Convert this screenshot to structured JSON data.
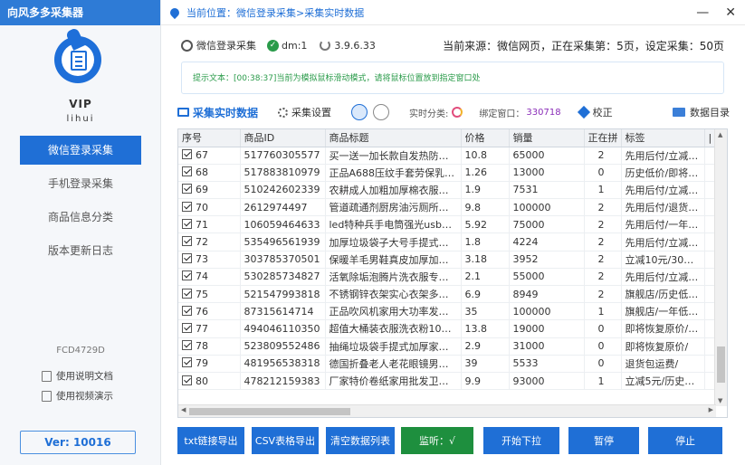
{
  "app": {
    "title": "向风多多采集器"
  },
  "sidebar": {
    "vip_label": "VIP",
    "username": "lihui",
    "nav": [
      {
        "label": "微信登录采集",
        "active": true
      },
      {
        "label": "手机登录采集",
        "active": false
      },
      {
        "label": "商品信息分类",
        "active": false
      },
      {
        "label": "版本更新日志",
        "active": false
      }
    ],
    "device_code": "FCD4729D",
    "links": {
      "doc": "使用说明文档",
      "video": "使用视频演示"
    },
    "version": "Ver: 10016"
  },
  "header": {
    "breadcrumb": "当前位置：微信登录采集>采集实时数据",
    "minimize": "—",
    "close": "✕"
  },
  "status": {
    "mode": "微信登录采集",
    "dm": "dm:1",
    "version": "3.9.6.33",
    "source_info": "当前来源：微信网页，正在采集第：5页，设定采集：50页"
  },
  "tip": "提示文本：[00:38:37]当前为模拟鼠标滑动模式，请将鼠标位置放到指定窗口处",
  "toolbar": {
    "tab_realtime": "采集实时数据",
    "tab_settings": "采集设置",
    "realtime_category": "实时分类:",
    "bind_window_label": "绑定窗口：",
    "bind_window_value": "330718",
    "calibrate": "校正",
    "data_dir": "数据目录"
  },
  "table": {
    "columns": [
      "序号",
      "商品ID",
      "商品标题",
      "价格",
      "销量",
      "正在拼",
      "标签",
      "|"
    ],
    "rows": [
      [
        "67",
        "517760305577",
        "买一送一加长款自发热防…",
        "10.8",
        "65000",
        "2",
        "先用后付/立减…"
      ],
      [
        "68",
        "517883810979",
        "正品A688压纹手套劳保乳…",
        "1.26",
        "13000",
        "0",
        "历史低价/即将…"
      ],
      [
        "69",
        "510242602339",
        "农耕成人加粗加厚棉衣服…",
        "1.9",
        "7531",
        "1",
        "先用后付/立减…"
      ],
      [
        "70",
        "2612974497",
        "管道疏通剂厨房油污厕所…",
        "9.8",
        "100000",
        "2",
        "先用后付/退货…"
      ],
      [
        "71",
        "106059464633",
        "led特种兵手电筒强光usb…",
        "5.92",
        "75000",
        "2",
        "先用后付/一年…"
      ],
      [
        "72",
        "535496561939",
        "加厚垃圾袋子大号手提式…",
        "1.8",
        "4224",
        "2",
        "先用后付/立减…"
      ],
      [
        "73",
        "303785370501",
        "保暖羊毛男鞋真皮加厚加…",
        "3.18",
        "3952",
        "2",
        "立减10元/30…"
      ],
      [
        "74",
        "530285734827",
        "活氧除垢泡腾片洗衣服专…",
        "2.1",
        "55000",
        "2",
        "先用后付/立减…"
      ],
      [
        "75",
        "521547993818",
        "不锈钢锌衣架实心衣架多…",
        "6.9",
        "8949",
        "2",
        "旗舰店/历史低…"
      ],
      [
        "76",
        "87315614714",
        "正品吹风机家用大功率发…",
        "35",
        "100000",
        "1",
        "旗舰店/一年低…"
      ],
      [
        "77",
        "494046110350",
        "超值大桶装衣服洗衣粉10…",
        "13.8",
        "19000",
        "0",
        "即将恢复原价/…"
      ],
      [
        "78",
        "523809552486",
        "抽绳垃圾袋手提式加厚家…",
        "2.9",
        "31000",
        "0",
        "即将恢复原价/"
      ],
      [
        "79",
        "481956538318",
        "德国折叠老人老花眼镜男…",
        "39",
        "5533",
        "0",
        "退货包运费/"
      ],
      [
        "80",
        "478212159383",
        "厂家特价卷纸家用批发卫…",
        "9.9",
        "93000",
        "1",
        "立减5元/历史…"
      ]
    ]
  },
  "buttons": {
    "txt_export": "txt链接导出",
    "csv_export": "CSV表格导出",
    "clear_list": "清空数据列表",
    "listen": "监听：√",
    "start_pull": "开始下拉",
    "pause": "暂停",
    "stop": "停止"
  },
  "colors": {
    "accent": "#1f6fd6",
    "listen_green": "#1e8f3e",
    "tip_green": "#2a9b4a"
  }
}
